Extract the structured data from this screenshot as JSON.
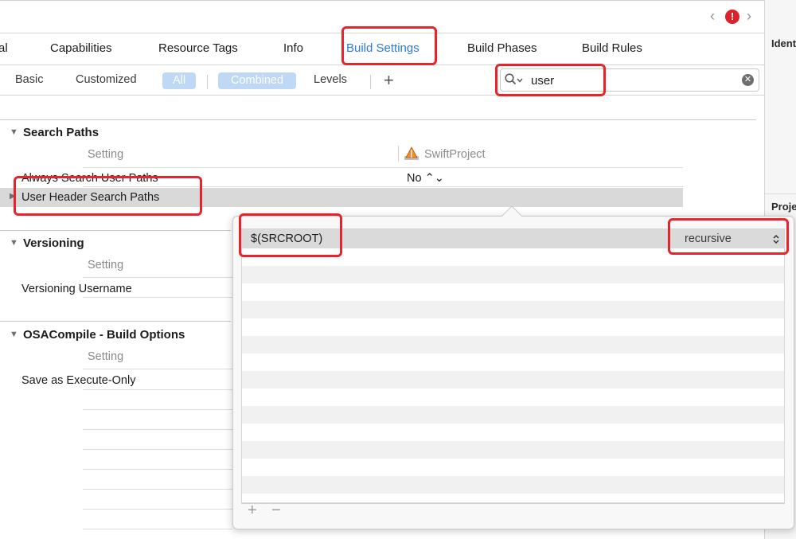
{
  "tabs": [
    {
      "label": "al"
    },
    {
      "label": "Capabilities"
    },
    {
      "label": "Resource Tags"
    },
    {
      "label": "Info"
    },
    {
      "label": "Build Settings"
    },
    {
      "label": "Build Phases"
    },
    {
      "label": "Build Rules"
    }
  ],
  "active_tab": "Build Settings",
  "filters": {
    "basic": "Basic",
    "customized": "Customized",
    "all": "All",
    "combined": "Combined",
    "levels": "Levels",
    "add": "+"
  },
  "search": {
    "value": "user"
  },
  "inspector": {
    "identity_label": "Identity",
    "project_label": "Project"
  },
  "sections": {
    "search_paths": {
      "title": "Search Paths",
      "column_setting": "Setting",
      "column_target": "SwiftProject",
      "rows": [
        {
          "name": "Always Search User Paths",
          "value": "No ⌃⌄"
        },
        {
          "name": "User Header Search Paths",
          "value": ""
        }
      ]
    },
    "versioning": {
      "title": "Versioning",
      "column_setting": "Setting",
      "rows": [
        {
          "name": "Versioning Username"
        }
      ]
    },
    "osacompile": {
      "title": "OSACompile - Build Options",
      "column_setting": "Setting",
      "rows": [
        {
          "name": "Save as Execute-Only"
        }
      ]
    }
  },
  "popover": {
    "entry_value": "$(SRCROOT)",
    "entry_option": "recursive",
    "add_label": "+",
    "remove_label": "−"
  },
  "colors": {
    "accent": "#2d7ad6",
    "pill": "#bfd8f5",
    "annotation": "#e9232a",
    "error": "#e0202a"
  }
}
